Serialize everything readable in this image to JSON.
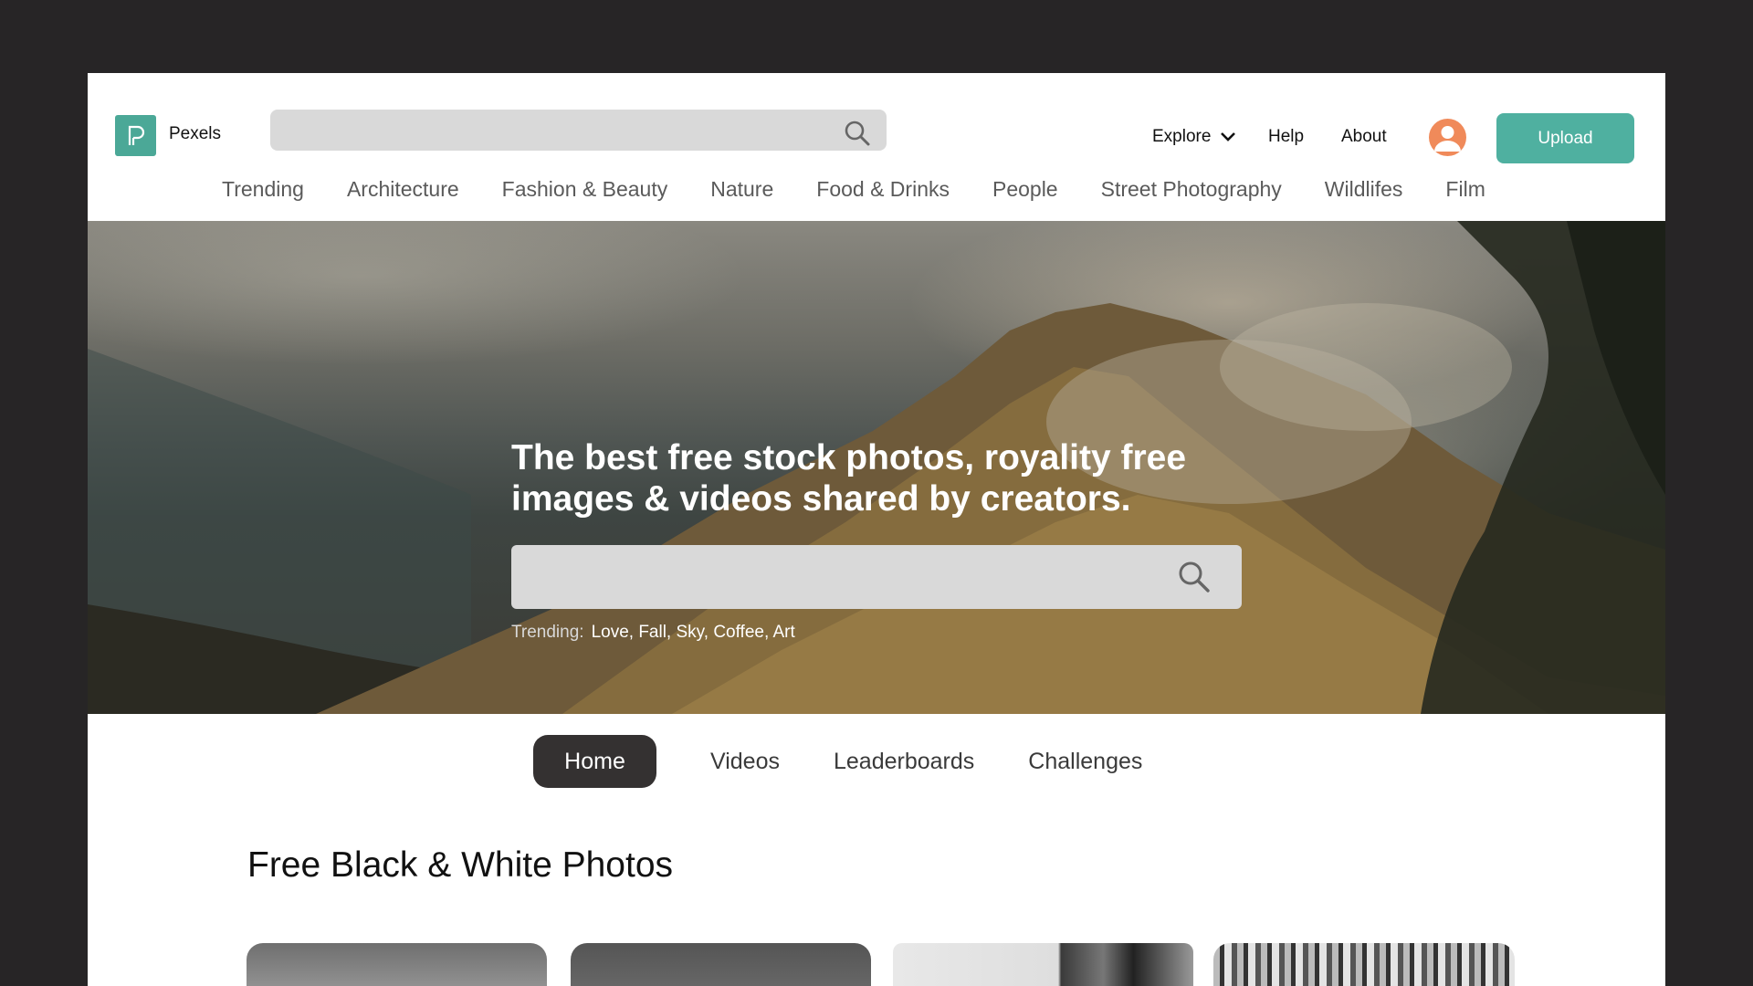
{
  "header": {
    "brand": "Pexels",
    "search_placeholder": "",
    "nav": {
      "explore": "Explore",
      "help": "Help",
      "about": "About"
    },
    "upload_label": "Upload"
  },
  "categories": [
    "Trending",
    "Architecture",
    "Fashion & Beauty",
    "Nature",
    "Food & Drinks",
    "People",
    "Street Photography",
    "Wildlifes",
    "Film"
  ],
  "hero": {
    "title": "The best free stock  photos, royality free images & videos shared by creators.",
    "search_placeholder": "",
    "trending_label": "Trending:",
    "trending_terms": "Love, Fall, Sky, Coffee, Art"
  },
  "tabs": [
    "Home",
    "Videos",
    "Leaderboards",
    "Challenges"
  ],
  "active_tab": "Home",
  "section_title": "Free Black & White Photos",
  "colors": {
    "brand": "#4ba897",
    "upload": "#4fb0a0",
    "active_tab": "#343131",
    "avatar": "#f08a5a",
    "backdrop": "#272526"
  },
  "icons": [
    "logo-icon",
    "search-icon",
    "chevron-down-icon",
    "user-icon"
  ]
}
